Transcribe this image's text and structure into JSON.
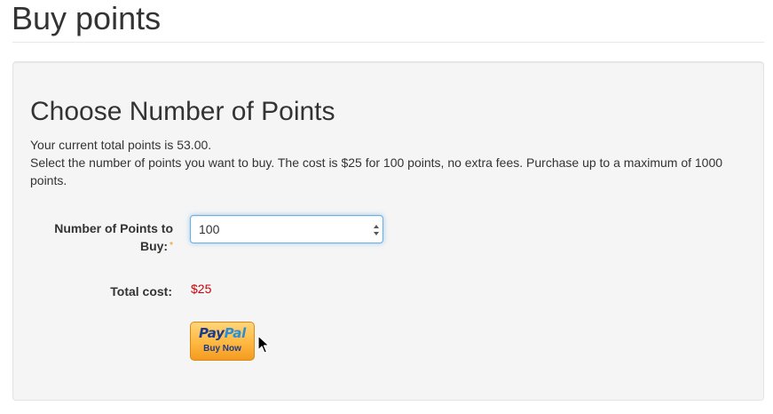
{
  "page": {
    "title": "Buy points"
  },
  "panel": {
    "heading": "Choose Number of Points",
    "current_points_text": "Your current total points is 53.00.",
    "instructions_text": "Select the number of points you want to buy. The cost is $25 for 100 points, no extra fees. Purchase up to a maximum of 1000 points."
  },
  "form": {
    "points_label": "Number of Points to Buy:",
    "required_marker": "*",
    "points_select": {
      "selected_value": "100"
    },
    "total_cost_label": "Total cost:",
    "total_cost_value": "$25"
  },
  "paypal_button": {
    "logo_left": "Pay",
    "logo_right": "Pal",
    "label": "Buy Now"
  },
  "colors": {
    "cost_value": "#c7000a",
    "required_marker": "#f0ad4e",
    "select_focus_border": "#66afe9",
    "paypal_orange": "#ffb840",
    "paypal_navy": "#1b3a8c",
    "paypal_blue": "#2c8fd6"
  },
  "icons": {
    "select_arrows": "select-arrows-icon",
    "cursor": "mouse-pointer-icon"
  }
}
